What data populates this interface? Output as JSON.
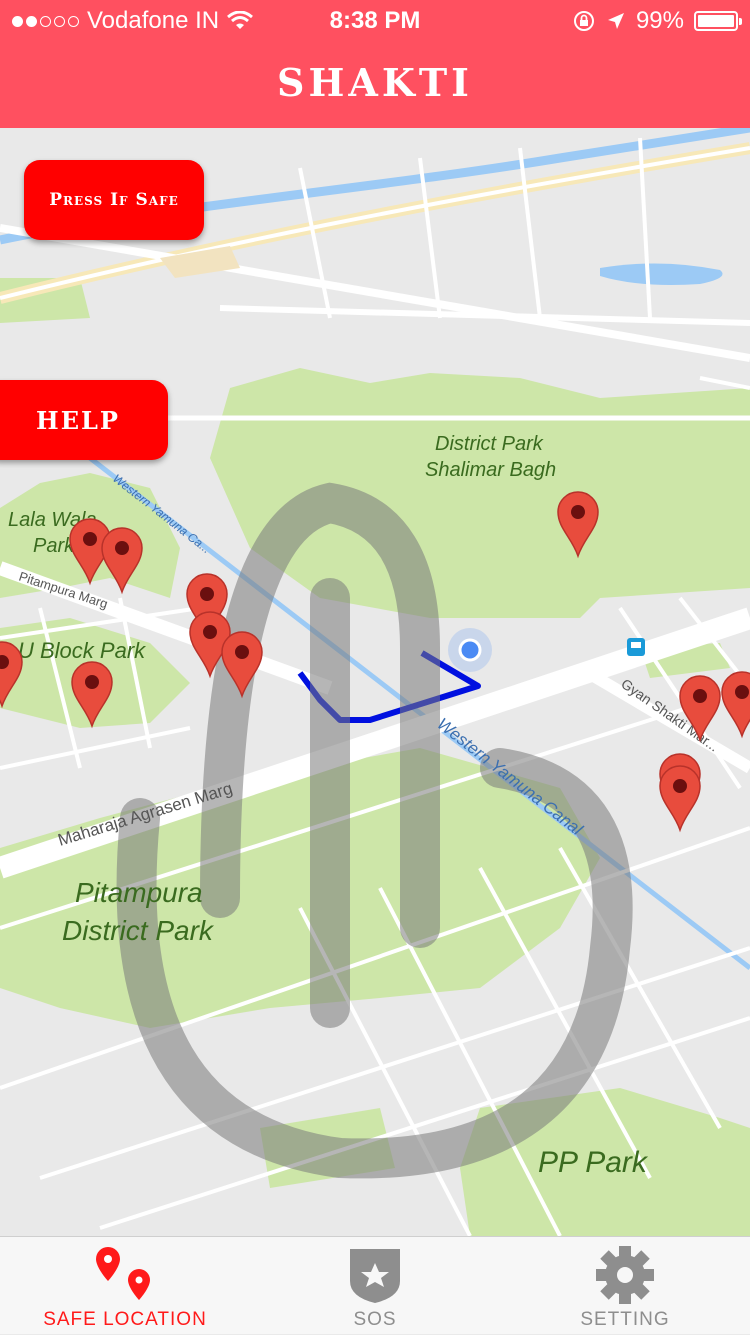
{
  "status": {
    "carrier": "Vodafone IN",
    "time": "8:38 PM",
    "battery": "99%",
    "signal_bars_filled": 2,
    "signal_bars_total": 5,
    "battery_level": 0.99
  },
  "app": {
    "title": "SHAKTI"
  },
  "buttons": {
    "safe": "Press If Safe",
    "help": "HELP"
  },
  "map": {
    "labels": {
      "district_park_1": "District Park",
      "district_park_2": "Shalimar Bagh",
      "lala_wala_1": "Lala Wala",
      "lala_wala_2": "Park",
      "pitampura_marg": "Pitampura Marg",
      "u_block_park": "U Block Park",
      "maharaja_road": "Maharaja Agrasen Marg",
      "pitampura_dp_1": "Pitampura",
      "pitampura_dp_2": "District Park",
      "western_canal": "Western Yamuna Canal",
      "western_canal_top": "Western Yamuna Ca...",
      "gyan_road": "Gyan Shakti Mar...",
      "pp_park": "PP Park"
    },
    "colors": {
      "park": "#cde6a8",
      "road": "#ffffff",
      "water": "#9ccaf5",
      "route": "#0010e0",
      "pin": "#e84c3d"
    },
    "icons": [
      "map-pin-icon",
      "current-location-icon",
      "bus-stop-icon",
      "watermark-logo"
    ]
  },
  "tabs": [
    {
      "label": "SAFE LOCATION",
      "icon": "map-pins-icon",
      "active": true
    },
    {
      "label": "SOS",
      "icon": "police-badge-icon",
      "active": false
    },
    {
      "label": "SETTING",
      "icon": "gear-icon",
      "active": false
    }
  ],
  "accent": "#ff5060"
}
